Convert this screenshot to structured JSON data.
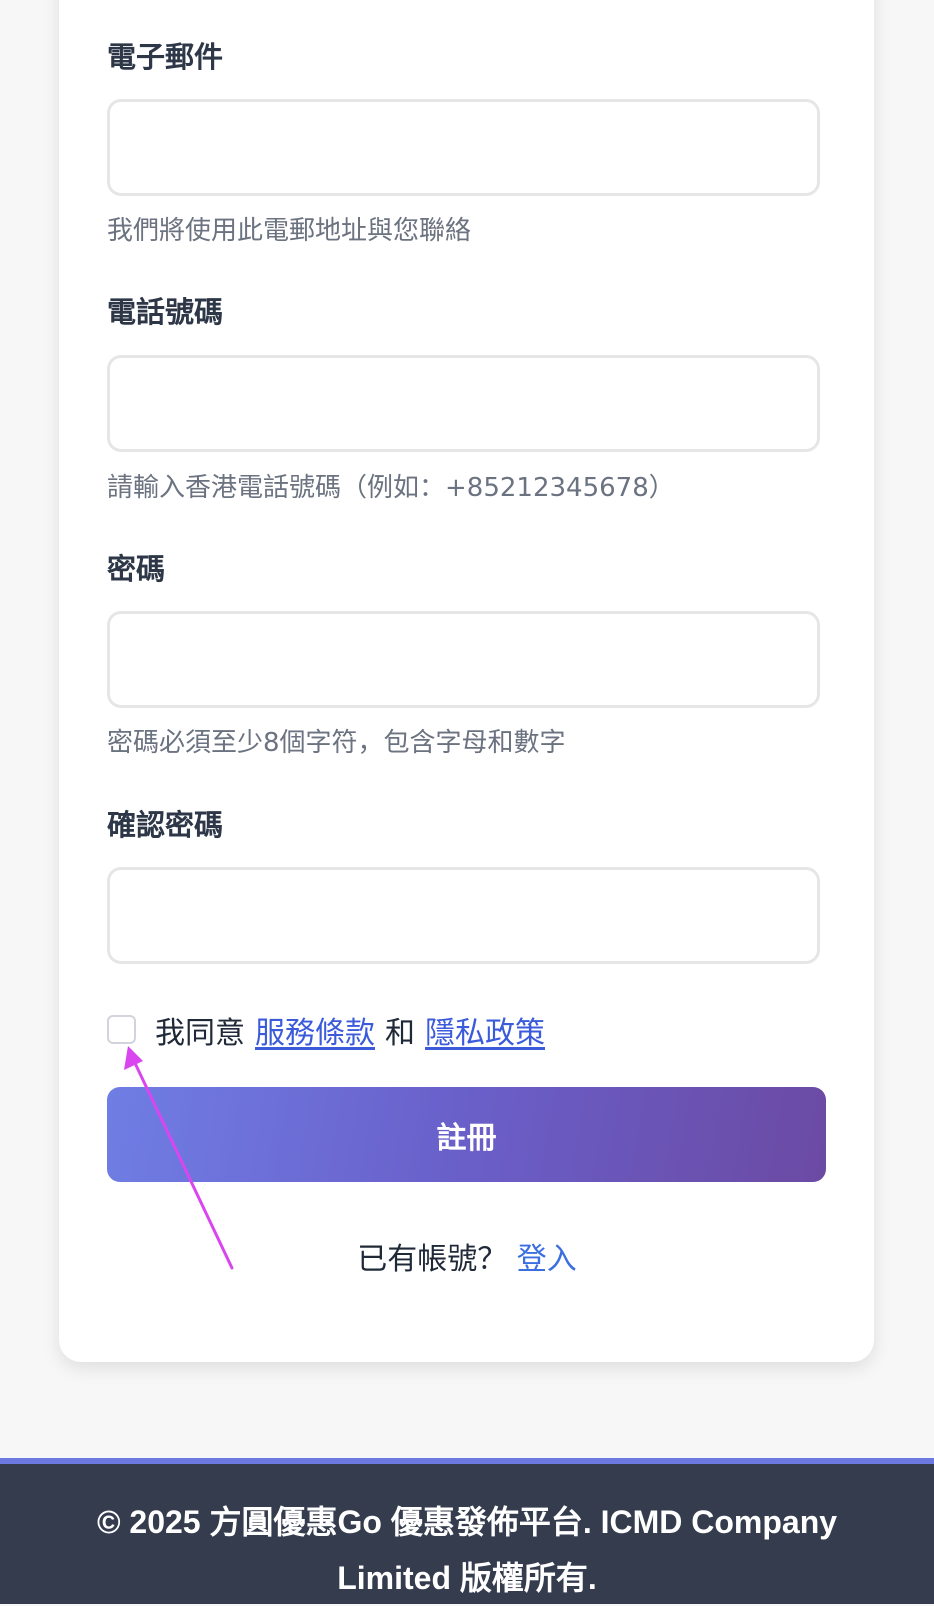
{
  "form": {
    "email": {
      "label": "電子郵件",
      "value": "",
      "placeholder": "",
      "hint": "我們將使用此電郵地址與您聯絡"
    },
    "phone": {
      "label": "電話號碼",
      "value": "",
      "placeholder": "",
      "hint": "請輸入香港電話號碼（例如：+85212345678）"
    },
    "password": {
      "label": "密碼",
      "value": "",
      "placeholder": "",
      "hint": "密碼必須至少8個字符，包含字母和數字"
    },
    "confirm_password": {
      "label": "確認密碼",
      "value": "",
      "placeholder": ""
    },
    "agree": {
      "checked": false,
      "prefix": "我同意",
      "terms_link": "服務條款",
      "conjunction": "和",
      "privacy_link": "隱私政策"
    },
    "submit_label": "註冊",
    "login_prompt": {
      "text": "已有帳號？",
      "link": "登入"
    }
  },
  "footer": {
    "copyright": "© 2025 方圓優惠Go 優惠發佈平台. ICMD Company Limited 版權所有."
  },
  "colors": {
    "page_background": "#f7f7f7",
    "card_background": "#ffffff",
    "button_gradient_start": "#6f7ee4",
    "button_gradient_end": "#6b4aa3",
    "link": "#3b5bdb",
    "footer_background": "#343c4e",
    "footer_accent": "#6b79e0",
    "annotation_arrow": "#d946ef"
  }
}
